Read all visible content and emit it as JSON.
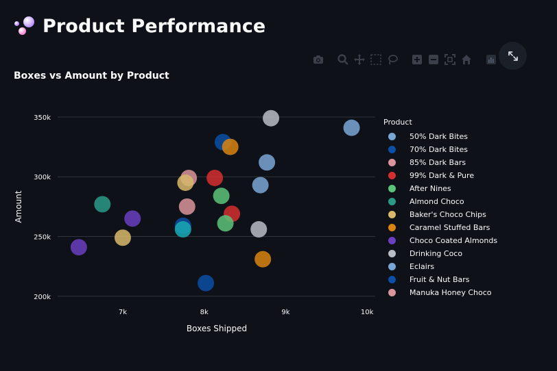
{
  "page": {
    "title": "Product Performance"
  },
  "chart_data": {
    "type": "scatter",
    "title": "Boxes vs Amount by Product",
    "xlabel": "Boxes Shipped",
    "ylabel": "Amount",
    "xlim": [
      6200,
      10100
    ],
    "ylim": [
      193000,
      362000
    ],
    "x_ticks": [
      7000,
      8000,
      9000,
      10000
    ],
    "x_tick_labels": [
      "7k",
      "8k",
      "9k",
      "10k"
    ],
    "y_ticks": [
      200000,
      250000,
      300000,
      350000
    ],
    "y_tick_labels": [
      "200k",
      "250k",
      "300k",
      "350k"
    ],
    "grid": "horizontal",
    "legend_title": "Product",
    "legend_position": "right",
    "series": [
      {
        "name": "50% Dark Bites",
        "color": "#7aa6d6",
        "points": [
          [
            8770,
            312000
          ],
          [
            8690,
            293000
          ]
        ]
      },
      {
        "name": "70% Dark Bites",
        "color": "#0b4fa6",
        "points": [
          [
            8230,
            329000
          ],
          [
            7740,
            259000
          ]
        ]
      },
      {
        "name": "85% Dark Bars",
        "color": "#d9959b",
        "points": [
          [
            7810,
            299000
          ]
        ]
      },
      {
        "name": "99% Dark & Pure",
        "color": "#d32f2f",
        "points": [
          [
            8130,
            299000
          ],
          [
            8340,
            269000
          ]
        ]
      },
      {
        "name": "After Nines",
        "color": "#5cc47a",
        "points": [
          [
            8210,
            284000
          ],
          [
            8260,
            261000
          ]
        ]
      },
      {
        "name": "Almond Choco",
        "color": "#2a9a87",
        "points": [
          [
            6750,
            277000
          ]
        ]
      },
      {
        "name": "Baker's Choco Chips",
        "color": "#d8b96b",
        "points": [
          [
            7770,
            295000
          ],
          [
            7000,
            249000
          ]
        ]
      },
      {
        "name": "Caramel Stuffed Bars",
        "color": "#d98512",
        "points": [
          [
            8320,
            325000
          ],
          [
            8720,
            231000
          ]
        ]
      },
      {
        "name": "Choco Coated Almonds",
        "color": "#6a3fc0",
        "points": [
          [
            7120,
            265000
          ],
          [
            6460,
            241000
          ]
        ]
      },
      {
        "name": "Drinking Coco",
        "color": "#b8bcc4",
        "points": [
          [
            8820,
            349000
          ],
          [
            8670,
            256000
          ]
        ]
      },
      {
        "name": "Eclairs",
        "color": "#7aa6d6",
        "points": [
          [
            9810,
            341000
          ]
        ]
      },
      {
        "name": "Fruit & Nut Bars",
        "color": "#0b4fa6",
        "points": [
          [
            8020,
            211000
          ]
        ]
      },
      {
        "name": "Manuka Honey Choco",
        "color": "#d9959b",
        "points": [
          [
            7790,
            275000
          ]
        ]
      },
      {
        "name": "",
        "color": "#1aa9b3",
        "points": [
          [
            7740,
            256000
          ]
        ]
      }
    ]
  }
}
